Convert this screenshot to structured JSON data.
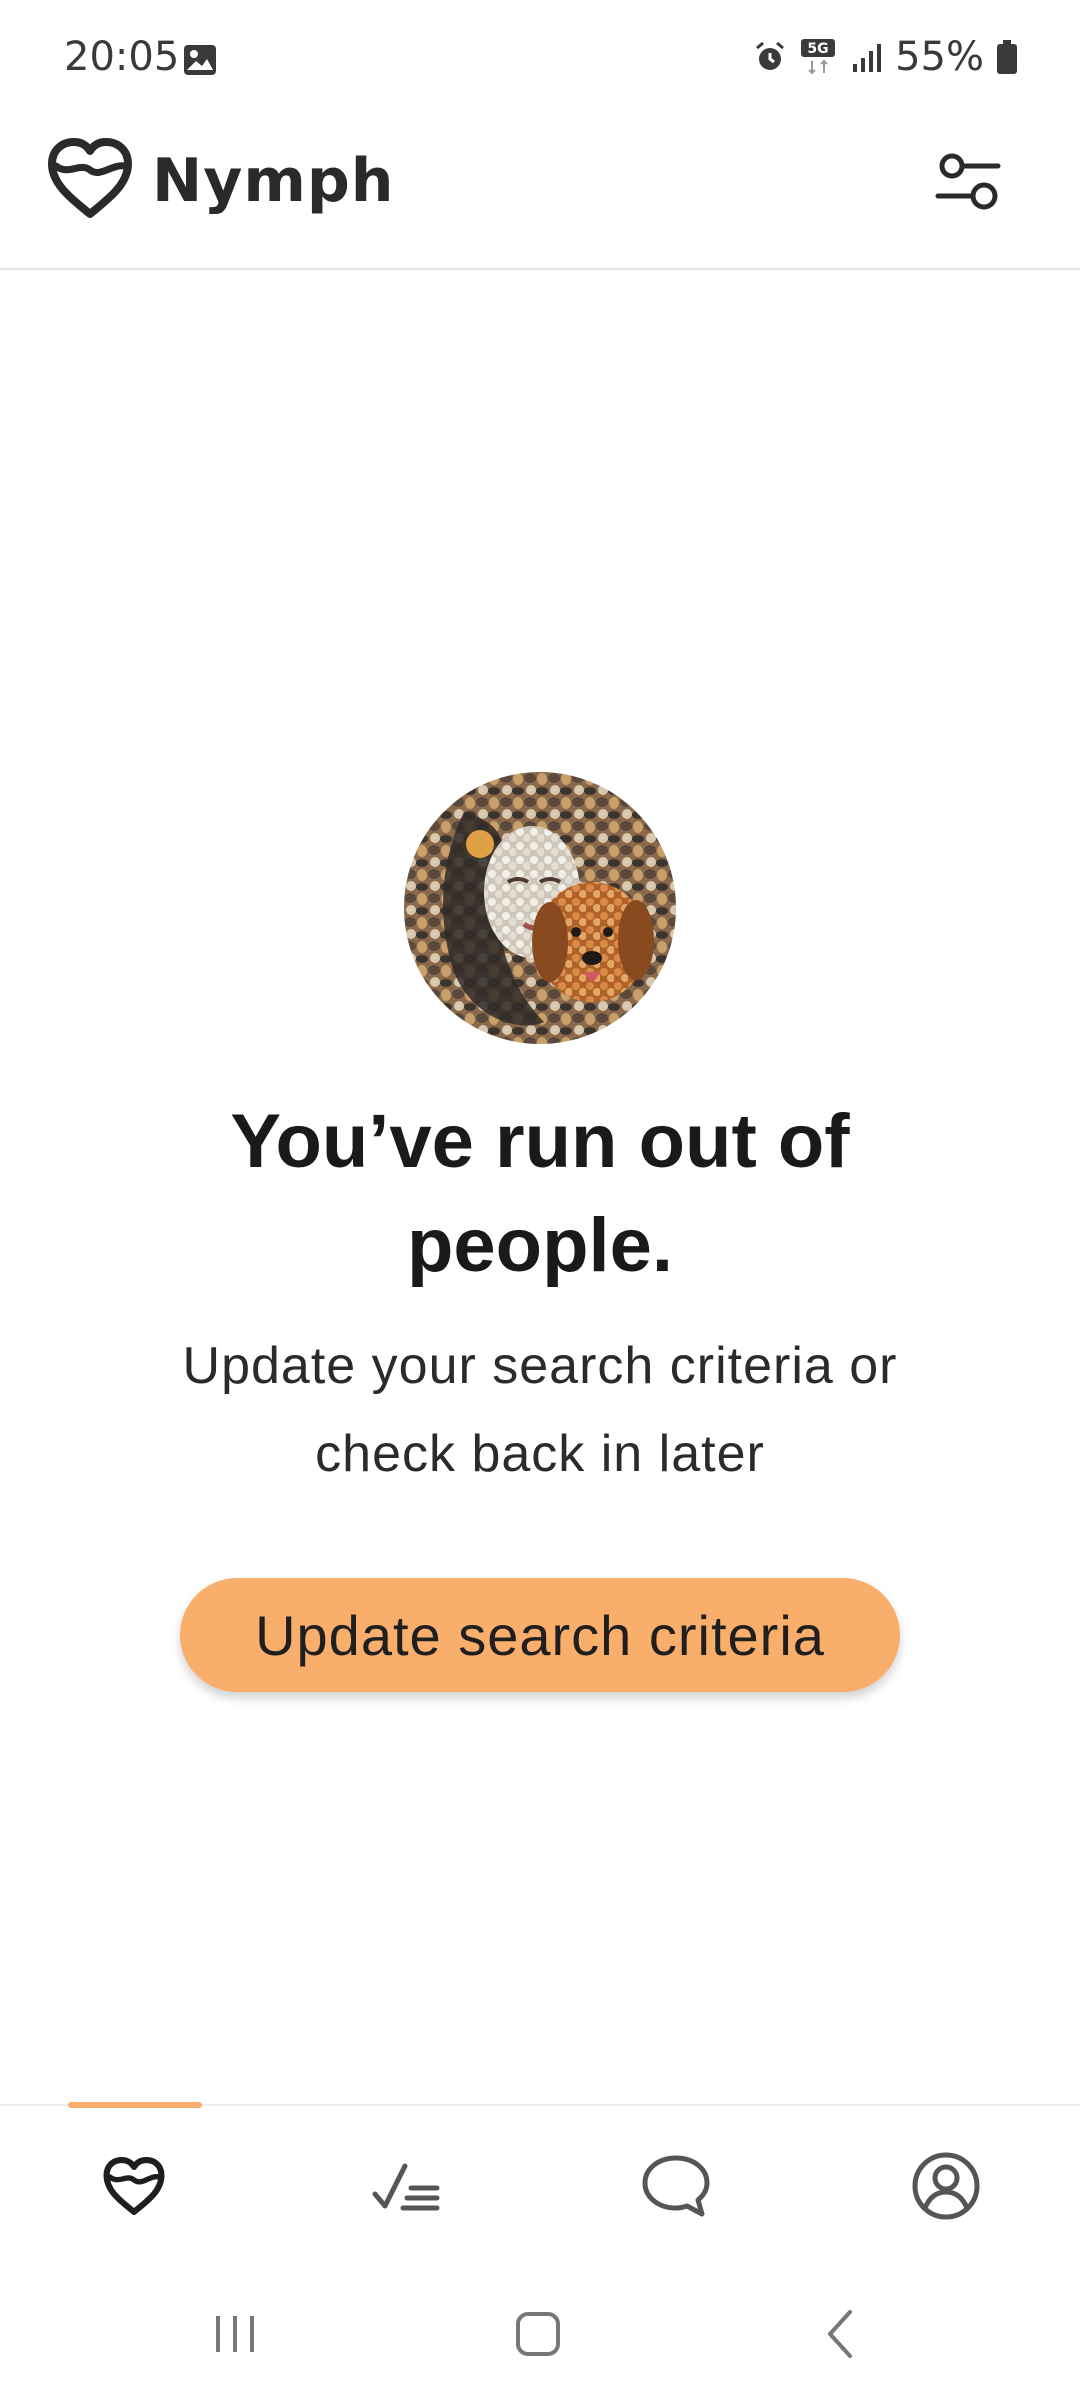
{
  "status_bar": {
    "time": "20:05",
    "battery": "55%",
    "icons": [
      "image-icon",
      "alarm-icon",
      "5g-icon",
      "signal-icon",
      "battery-icon"
    ]
  },
  "app_bar": {
    "title": "Nymph",
    "logo_icon": "heart-logo-icon",
    "filter_icon": "filter-sliders-icon"
  },
  "empty_state": {
    "headline_line1": "You’ve run out of",
    "headline_line2": "people.",
    "subtext_line1": "Update your search criteria or",
    "subtext_line2": "check back in later",
    "button_label": "Update search criteria"
  },
  "bottom_nav": {
    "items": [
      {
        "name": "discover",
        "icon": "heart-icon",
        "active": true
      },
      {
        "name": "list",
        "icon": "checklist-icon",
        "active": false
      },
      {
        "name": "chat",
        "icon": "chat-bubble-icon",
        "active": false
      },
      {
        "name": "profile",
        "icon": "profile-icon",
        "active": false
      }
    ]
  },
  "colors": {
    "accent": "#f9ae6b",
    "text": "#1a1a1a"
  }
}
